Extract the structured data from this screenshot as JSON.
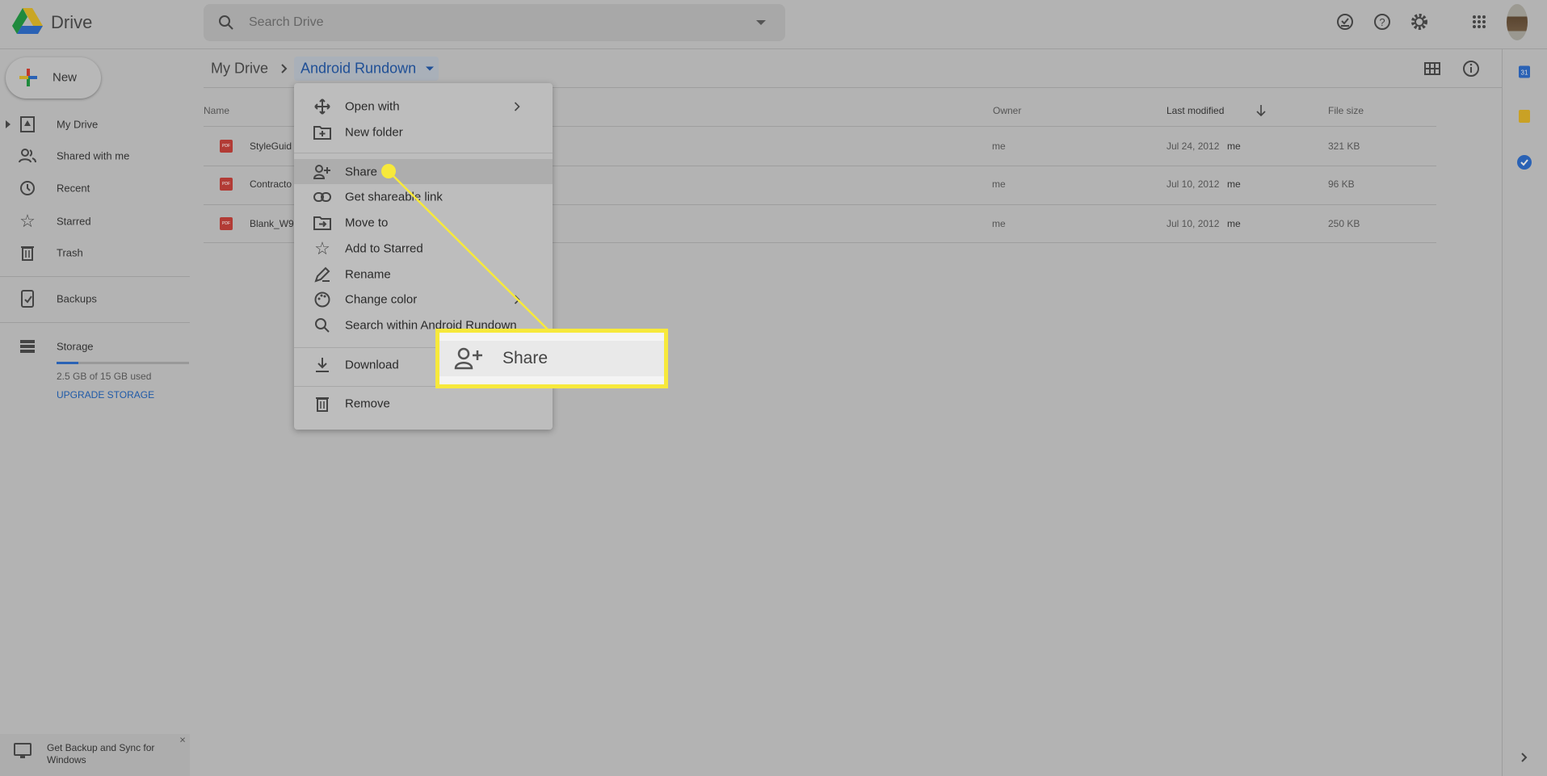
{
  "app": {
    "name": "Drive"
  },
  "search": {
    "placeholder": "Search Drive"
  },
  "header_icons": [
    "offline-ready-icon",
    "help-icon",
    "settings-icon",
    "apps-grid-icon",
    "avatar"
  ],
  "new_button": {
    "label": "New"
  },
  "sidebar": {
    "items": [
      {
        "label": "My Drive",
        "icon": "my-drive-icon"
      },
      {
        "label": "Shared with me",
        "icon": "shared-icon"
      },
      {
        "label": "Recent",
        "icon": "clock-icon"
      },
      {
        "label": "Starred",
        "icon": "star-icon"
      },
      {
        "label": "Trash",
        "icon": "trash-icon"
      },
      {
        "label": "Backups",
        "icon": "backups-icon"
      }
    ],
    "storage": {
      "label": "Storage",
      "used_text": "2.5 GB of 15 GB used",
      "used_fraction": 0.167,
      "upgrade": "UPGRADE STORAGE"
    }
  },
  "breadcrumb": {
    "root": "My Drive",
    "current": "Android Rundown"
  },
  "table": {
    "headers": {
      "name": "Name",
      "owner": "Owner",
      "modified": "Last modified",
      "size": "File size"
    },
    "rows": [
      {
        "name": "StyleGuid",
        "owner": "me",
        "modified": "Jul 24, 2012",
        "modified_by": "me",
        "size": "321 KB"
      },
      {
        "name": "Contracto",
        "owner": "me",
        "modified": "Jul 10, 2012",
        "modified_by": "me",
        "size": "96 KB"
      },
      {
        "name": "Blank_W9",
        "owner": "me",
        "modified": "Jul 10, 2012",
        "modified_by": "me",
        "size": "250 KB"
      }
    ],
    "file_badge": "PDF"
  },
  "context_menu": {
    "items": [
      {
        "label": "Open with",
        "icon": "open-with-icon"
      },
      {
        "label": "New folder",
        "icon": "new-folder-icon"
      },
      {
        "label": "Share",
        "icon": "share-person-add-icon"
      },
      {
        "label": "Get shareable link",
        "icon": "link-icon"
      },
      {
        "label": "Move to",
        "icon": "move-to-icon"
      },
      {
        "label": "Add to Starred",
        "icon": "star-icon"
      },
      {
        "label": "Rename",
        "icon": "rename-icon"
      },
      {
        "label": "Change color",
        "icon": "palette-icon"
      },
      {
        "label": "Search within Android Rundown",
        "icon": "search-icon"
      },
      {
        "label": "Download",
        "icon": "download-icon"
      },
      {
        "label": "Remove",
        "icon": "trash-icon"
      }
    ]
  },
  "callout": {
    "label": "Share",
    "color": "#f7e93b"
  },
  "notification": {
    "text": "Get Backup and Sync for Windows",
    "close": "×"
  },
  "side_panel": {
    "calendar_day": "31"
  }
}
